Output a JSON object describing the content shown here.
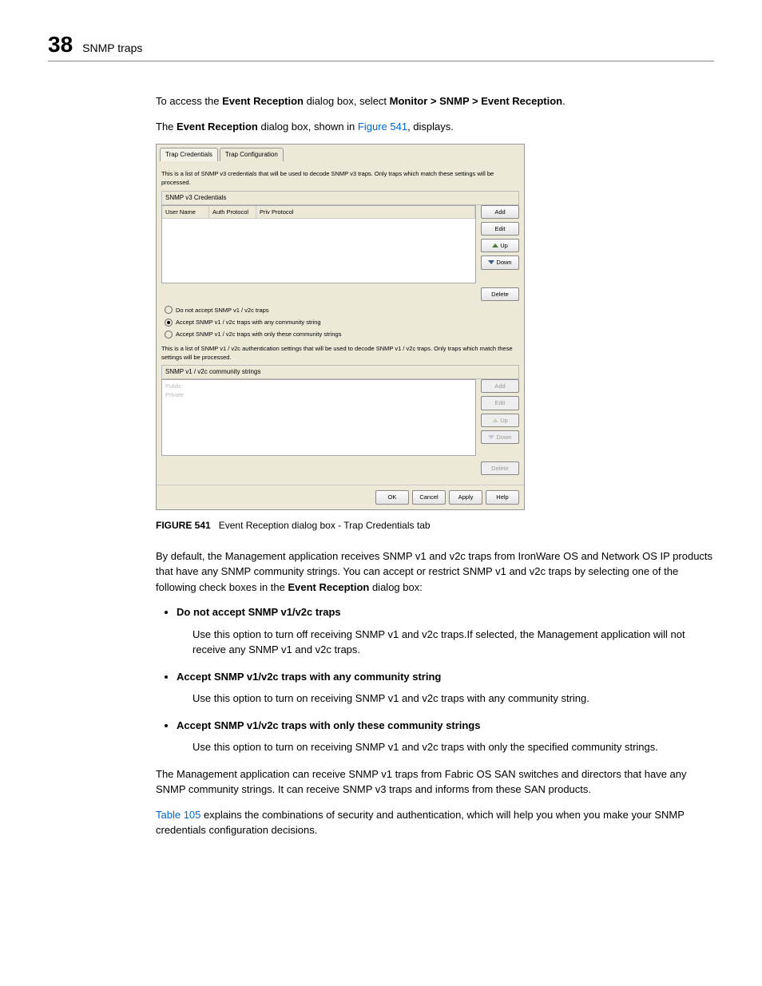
{
  "header": {
    "page_number": "38",
    "title": "SNMP traps"
  },
  "intro": {
    "p1_prefix": "To access the ",
    "p1_bold1": "Event Reception",
    "p1_mid": " dialog box, select ",
    "p1_bold2": "Monitor > SNMP > Event Reception",
    "p1_suffix": ".",
    "p2_prefix": "The ",
    "p2_bold": "Event Reception",
    "p2_mid": " dialog box, shown in ",
    "p2_link": "Figure 541",
    "p2_suffix": ", displays."
  },
  "dialog": {
    "tabs": [
      "Trap Credentials",
      "Trap Configuration"
    ],
    "desc_v3": "This is a list of SNMP v3 credentials that will be used to decode SNMP v3 traps. Only traps which match these settings will be processed.",
    "section_v3": "SNMP v3 Credentials",
    "cols": {
      "user": "User Name",
      "auth": "Auth Protocol",
      "priv": "Priv Protocol"
    },
    "btns": {
      "add": "Add",
      "edit": "Edit",
      "up": "Up",
      "down": "Down",
      "delete": "Delete"
    },
    "radio1": "Do not accept SNMP v1 / v2c traps",
    "radio2": "Accept SNMP v1 / v2c traps with any community string",
    "radio3": "Accept SNMP v1 / v2c traps with only these community strings",
    "desc_v12": "This is a list of SNMP v1 / v2c authentication settings that will be used to decode SNMP v1 / v2c traps. Only traps which match these settings will be processed.",
    "section_v12": "SNMP v1 / v2c community strings",
    "community": [
      "Public",
      "Private"
    ],
    "footer": {
      "ok": "OK",
      "cancel": "Cancel",
      "apply": "Apply",
      "help": "Help"
    }
  },
  "figure": {
    "label": "FIGURE 541",
    "caption": "Event Reception dialog box - Trap Credentials tab"
  },
  "body": {
    "p3_prefix": "By default, the Management application receives SNMP v1 and v2c traps from IronWare OS and Network OS IP products that have any SNMP community strings. You can accept or restrict SNMP v1 and v2c traps by selecting one of the following check boxes in the ",
    "p3_bold": "Event Reception",
    "p3_suffix": " dialog box:",
    "bullets": [
      {
        "title": "Do not accept SNMP v1/v2c traps",
        "text": "Use this option to turn off receiving SNMP v1 and v2c traps.If selected, the Management application will not receive any SNMP v1 and v2c traps."
      },
      {
        "title": "Accept SNMP v1/v2c traps with any community string",
        "text": "Use this option to turn on receiving SNMP v1 and v2c traps with any community string."
      },
      {
        "title": "Accept SNMP v1/v2c traps with only these community strings",
        "text": "Use this option to turn on receiving SNMP v1 and v2c traps with only the specified community strings."
      }
    ],
    "p4": "The Management application can receive SNMP v1 traps from Fabric OS SAN switches and directors that have any SNMP community strings. It can receive SNMP v3 traps and informs from these SAN products.",
    "p5_link": "Table 105",
    "p5_text": " explains the combinations of security and authentication, which will help you when you make your SNMP credentials configuration decisions."
  }
}
